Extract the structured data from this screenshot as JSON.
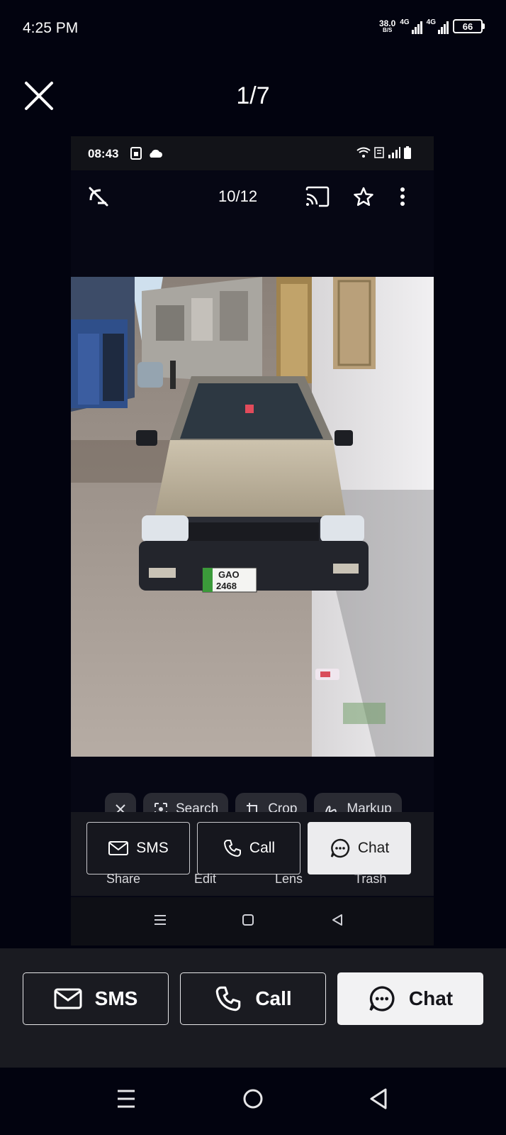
{
  "status_bar": {
    "time": "4:25 PM",
    "net_speed_value": "38.0",
    "net_speed_unit": "B/S",
    "sim1_label": "4G",
    "sim2_label": "4G",
    "battery": "66"
  },
  "viewer": {
    "counter": "1/7",
    "close_icon": "close-icon"
  },
  "embedded": {
    "status_time": "08:43",
    "counter": "10/12",
    "lens": {
      "search": "Search",
      "crop": "Crop",
      "markup": "Markup"
    },
    "actions": {
      "sms": "SMS",
      "call": "Call",
      "chat": "Chat"
    },
    "overlay_labels": {
      "share": "Share",
      "edit": "Edit",
      "lens": "Lens",
      "trash": "Trash"
    },
    "plate_line1": "GAO",
    "plate_line2": "2468"
  },
  "actions": {
    "sms": "SMS",
    "call": "Call",
    "chat": "Chat"
  },
  "colors": {
    "background": "#02030f",
    "action_bar": "#1a1b21",
    "chat_button": "#f2f2f3"
  }
}
